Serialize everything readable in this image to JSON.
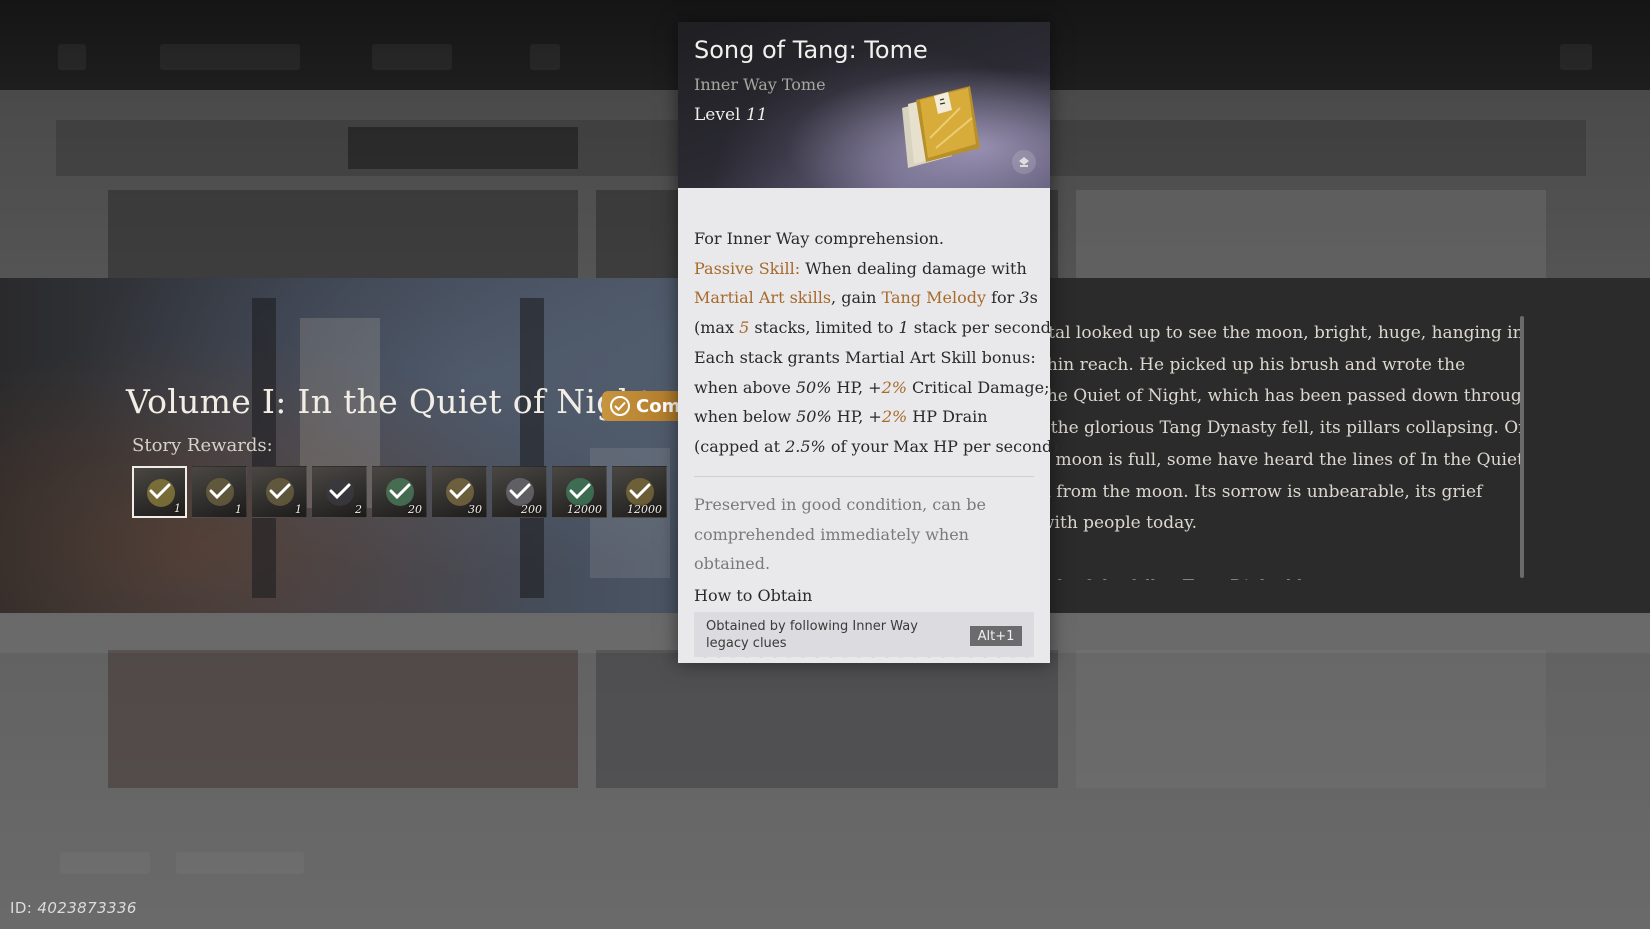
{
  "tooltip": {
    "name": "Song of Tang: Tome",
    "type": "Inner Way Tome",
    "level_label": "Level",
    "level_value": "11",
    "desc": {
      "l1": "For Inner Way comprehension.",
      "passive_label": "Passive Skill:",
      "l2_rest": " When dealing damage with",
      "martial_art_skills": "Martial Art skills",
      "l3_mid": ", gain ",
      "tang_melody": "Tang Melody",
      "l3_for": " for ",
      "l3_dur": "3",
      "l3_s": "s",
      "l4_a": "(max ",
      "max_stacks": "5",
      "l4_b": " stacks, limited to ",
      "limit": "1",
      "l4_c": " stack per second).",
      "l5": " Each stack grants Martial Art Skill bonus:",
      "l6_a": "when above ",
      "hp_threshold_a": "50%",
      "l6_b": " HP, +",
      "crit_bonus": "2%",
      "l6_c": " Critical Damage;",
      "l7_a": "when below ",
      "hp_threshold_b": "50%",
      "l7_b": " HP, +",
      "drain_bonus": "2%",
      "l7_c": " HP Drain",
      "l8_a": "(capped at ",
      "cap": "2.5%",
      "l8_b": " of your Max HP per second)."
    },
    "flavor": "Preserved in good condition, can be comprehended immediately when obtained.",
    "how_to_obtain": "How to Obtain",
    "obtain_text": "Obtained by following Inner Way legacy clues",
    "hotkey": "Alt+1"
  },
  "story": {
    "volume_title": "Volume I: In the Quiet of Night",
    "completed_label": "Com",
    "rewards_label": "Story Rewards:",
    "rewards": [
      {
        "qty": "1",
        "icon": "tome-icon",
        "tint": "#8a7a3a"
      },
      {
        "qty": "1",
        "icon": "scroll-icon",
        "tint": "#6a6040"
      },
      {
        "qty": "1",
        "icon": "brush-icon",
        "tint": "#6a6040"
      },
      {
        "qty": "2",
        "icon": "ink-icon",
        "tint": "#3a3a40"
      },
      {
        "qty": "20",
        "icon": "jade-icon",
        "tint": "#4a7a5a"
      },
      {
        "qty": "30",
        "icon": "coin-icon",
        "tint": "#7a6a40"
      },
      {
        "qty": "200",
        "icon": "silver-icon",
        "tint": "#6a6a70"
      },
      {
        "qty": "12000",
        "icon": "jade-leaf-icon",
        "tint": "#3f7a5a"
      },
      {
        "qty": "12000",
        "icon": "gold-coin-icon",
        "tint": "#7a6a3a"
      }
    ],
    "text_lines": [
      "rtal looked up to see the moon, bright, huge, hanging in",
      "thin reach. He picked up his brush and wrote the",
      " the Quiet of Night, which has been passed down through",
      ", the glorious Tang Dynasty fell, its pillars collapsing. On",
      "e moon is full, some have heard the lines of In the Quiet",
      "d from the moon. Its sorrow is unbearable, its grief",
      "with people today.",
      "",
      "i  the        f the fallen Tang Dinle    d  l"
    ]
  },
  "footer": {
    "id_label": "ID: ",
    "id_value": "4023873336"
  },
  "colors": {
    "accent": "#a76a2a",
    "badge": "#c8943e",
    "tooltip_bg": "#e9e9ec"
  }
}
